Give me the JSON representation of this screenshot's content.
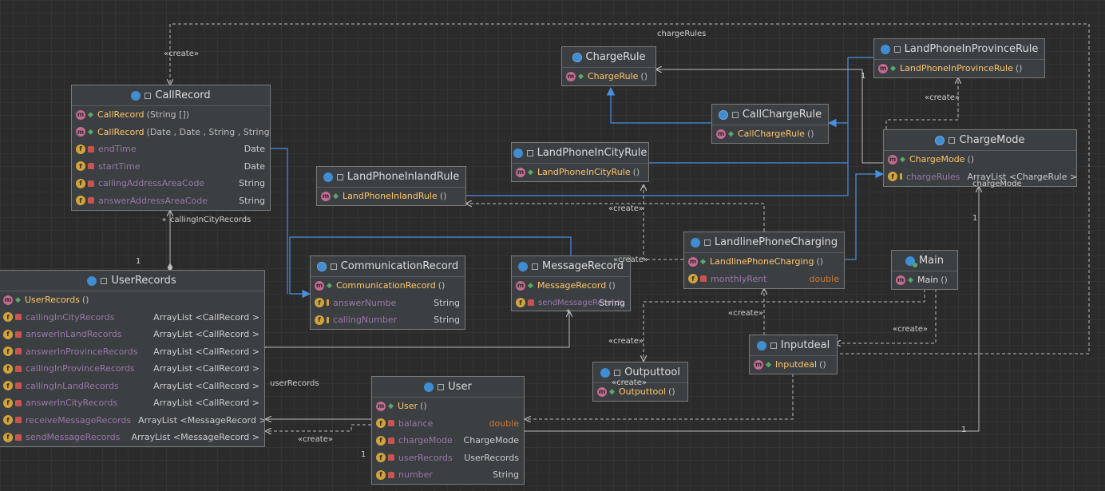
{
  "classes": {
    "chargerule": {
      "name": "ChargeRule",
      "methods": [
        {
          "name": "ChargeRule",
          "params": "()"
        }
      ]
    },
    "landphoneinprovincerule": {
      "name": "LandPhoneInProvinceRule",
      "methods": [
        {
          "name": "LandPhoneInProvinceRule",
          "params": "()"
        }
      ]
    },
    "callchargerule": {
      "name": "CallChargeRule",
      "methods": [
        {
          "name": "CallChargeRule",
          "params": "()"
        }
      ]
    },
    "chargemode": {
      "name": "ChargeMode",
      "methods": [
        {
          "name": "ChargeMode",
          "params": "()"
        }
      ],
      "fields": [
        {
          "name": "chargeRules",
          "type": "ArrayList <ChargeRule >"
        }
      ]
    },
    "landphoneincityrule": {
      "name": "LandPhoneInCityRule",
      "methods": [
        {
          "name": "LandPhoneInCityRule",
          "params": "()"
        }
      ]
    },
    "landphoneinlandrule": {
      "name": "LandPhoneInlandRule",
      "methods": [
        {
          "name": "LandPhoneInlandRule",
          "params": "()"
        }
      ]
    },
    "callrecord": {
      "name": "CallRecord",
      "methods": [
        {
          "name": "CallRecord",
          "params": "(String [])"
        },
        {
          "name": "CallRecord",
          "params": "(Date , Date , String , String )"
        }
      ],
      "fields": [
        {
          "name": "endTime",
          "type": "Date"
        },
        {
          "name": "startTime",
          "type": "Date"
        },
        {
          "name": "callingAddressAreaCode",
          "type": "String"
        },
        {
          "name": "answerAddressAreaCode",
          "type": "String"
        }
      ]
    },
    "communicationrecord": {
      "name": "CommunicationRecord",
      "methods": [
        {
          "name": "CommunicationRecord",
          "params": "()"
        }
      ],
      "fields": [
        {
          "name": "answerNumbe",
          "type": "String"
        },
        {
          "name": "callingNumber",
          "type": "String"
        }
      ]
    },
    "messagerecord": {
      "name": "MessageRecord",
      "methods": [
        {
          "name": "MessageRecord",
          "params": "()"
        }
      ],
      "fields": [
        {
          "name": "sendMessageRecords",
          "overlay": "sendMessageRecords",
          "type": "String"
        }
      ]
    },
    "landlinephonecharging": {
      "name": "LandlinePhoneCharging",
      "methods": [
        {
          "name": "LandlinePhoneCharging",
          "params": "()"
        }
      ],
      "fields": [
        {
          "name": "monthlyRent",
          "type": "double"
        }
      ]
    },
    "main": {
      "name": "Main",
      "methods": [
        {
          "name": "Main",
          "params": "()"
        }
      ]
    },
    "inputdeal": {
      "name": "Inputdeal",
      "methods": [
        {
          "name": "Inputdeal",
          "params": "()"
        }
      ]
    },
    "outputtool": {
      "name": "Outputtool",
      "methods": [
        {
          "name": "Outputtool",
          "params": "()"
        }
      ]
    },
    "userrecords": {
      "name": "UserRecords",
      "methods": [
        {
          "name": "UserRecords",
          "params": "()"
        }
      ],
      "fields": [
        {
          "name": "callingInCityRecords",
          "type": "ArrayList <CallRecord >"
        },
        {
          "name": "answerInLandRecords",
          "type": "ArrayList <CallRecord >"
        },
        {
          "name": "answerInProvinceRecords",
          "type": "ArrayList <CallRecord >"
        },
        {
          "name": "callingInProvinceRecords",
          "type": "ArrayList <CallRecord >"
        },
        {
          "name": "callingInLandRecords",
          "type": "ArrayList <CallRecord >"
        },
        {
          "name": "answerInCityRecords",
          "type": "ArrayList <CallRecord >"
        },
        {
          "name": "receiveMessageRecords",
          "type": "ArrayList <MessageRecord >"
        },
        {
          "name": "sendMessageRecords",
          "type": "ArrayList <MessageRecord >"
        }
      ]
    },
    "user": {
      "name": "User",
      "methods": [
        {
          "name": "User",
          "params": "()"
        }
      ],
      "fields": [
        {
          "name": "balance",
          "type": "double"
        },
        {
          "name": "chargeMode",
          "type": "ChargeMode"
        },
        {
          "name": "userRecords",
          "type": "UserRecords"
        },
        {
          "name": "number",
          "type": "String"
        }
      ]
    }
  },
  "edge_labels": {
    "charge_rules": "chargeRules",
    "create": "«create»",
    "calling_in_city_records": "callingInCityRecords",
    "user_records": "userRecords",
    "charge_mode": "chargeMode",
    "one": "1",
    "star": "*"
  },
  "colors": {
    "canvas": "#2b2b2b",
    "node": "#3c3f41",
    "inherit_edge": "#4a8fe0",
    "dependency_edge": "#bbbbbb",
    "method_name": "#ffc66d",
    "field_name": "#9876aa"
  }
}
